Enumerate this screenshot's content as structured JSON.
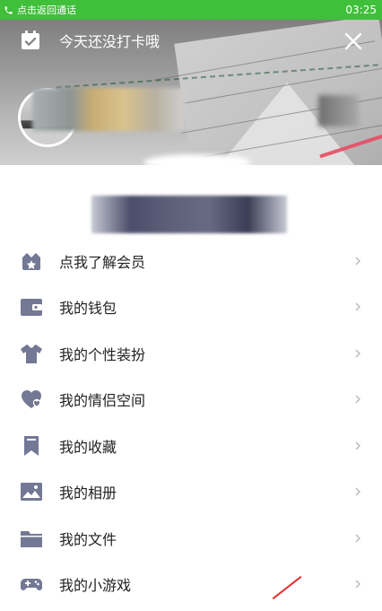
{
  "status_bar": {
    "call_label": "点击返回通话",
    "time": "03:25",
    "bg_color": "#3fbf3a"
  },
  "header": {
    "checkin_text": "今天还没打卡哦",
    "checkin_icon": "calendar-check-icon",
    "close_icon": "close-icon"
  },
  "menu": {
    "icon_color": "#737894",
    "items": [
      {
        "label": "点我了解会员",
        "icon": "vip-bag-icon"
      },
      {
        "label": "我的钱包",
        "icon": "wallet-icon"
      },
      {
        "label": "我的个性装扮",
        "icon": "tshirt-icon"
      },
      {
        "label": "我的情侣空间",
        "icon": "heart-icon"
      },
      {
        "label": "我的收藏",
        "icon": "bookmark-icon"
      },
      {
        "label": "我的相册",
        "icon": "photo-icon"
      },
      {
        "label": "我的文件",
        "icon": "folder-icon"
      },
      {
        "label": "我的小游戏",
        "icon": "gamepad-icon"
      }
    ]
  }
}
